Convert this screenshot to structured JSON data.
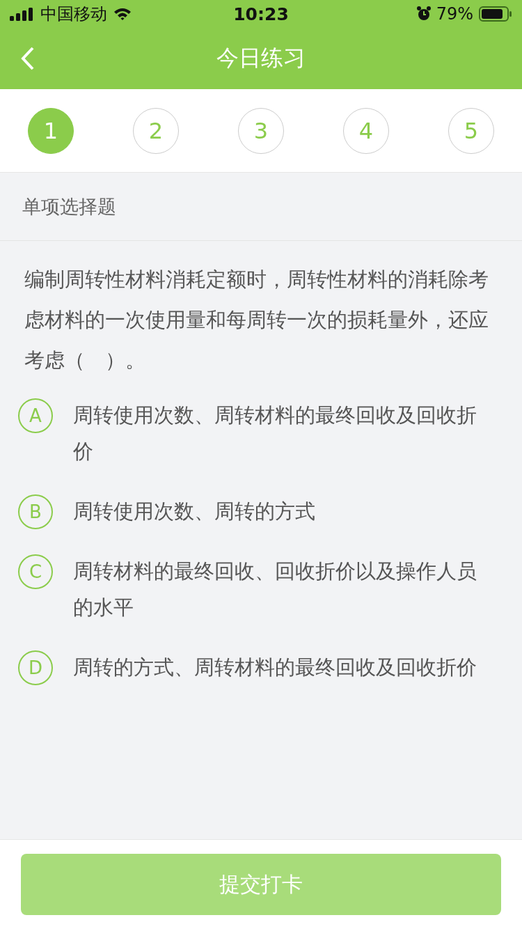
{
  "status_bar": {
    "carrier": "中国移动",
    "time": "10:23",
    "battery": "79%"
  },
  "nav": {
    "title": "今日练习"
  },
  "steps": [
    {
      "label": "1",
      "selected": true
    },
    {
      "label": "2",
      "selected": false
    },
    {
      "label": "3",
      "selected": false
    },
    {
      "label": "4",
      "selected": false
    },
    {
      "label": "5",
      "selected": false
    }
  ],
  "question_type": "单项选择题",
  "question": "编制周转性材料消耗定额时，周转性材料的消耗除考虑材料的一次使用量和每周转一次的损耗量外，还应考虑（　）。",
  "options": [
    {
      "letter": "A",
      "text": "周转使用次数、周转材料的最终回收及回收折价",
      "selected": false
    },
    {
      "letter": "B",
      "text": "周转使用次数、周转的方式",
      "selected": false
    },
    {
      "letter": "C",
      "text": "周转材料的最终回收、回收折价以及操作人员的水平",
      "selected": false
    },
    {
      "letter": "D",
      "text": "周转的方式、周转材料的最终回收及回收折价",
      "selected": false
    }
  ],
  "submit_button": {
    "label": "提交打卡",
    "disabled": true
  }
}
